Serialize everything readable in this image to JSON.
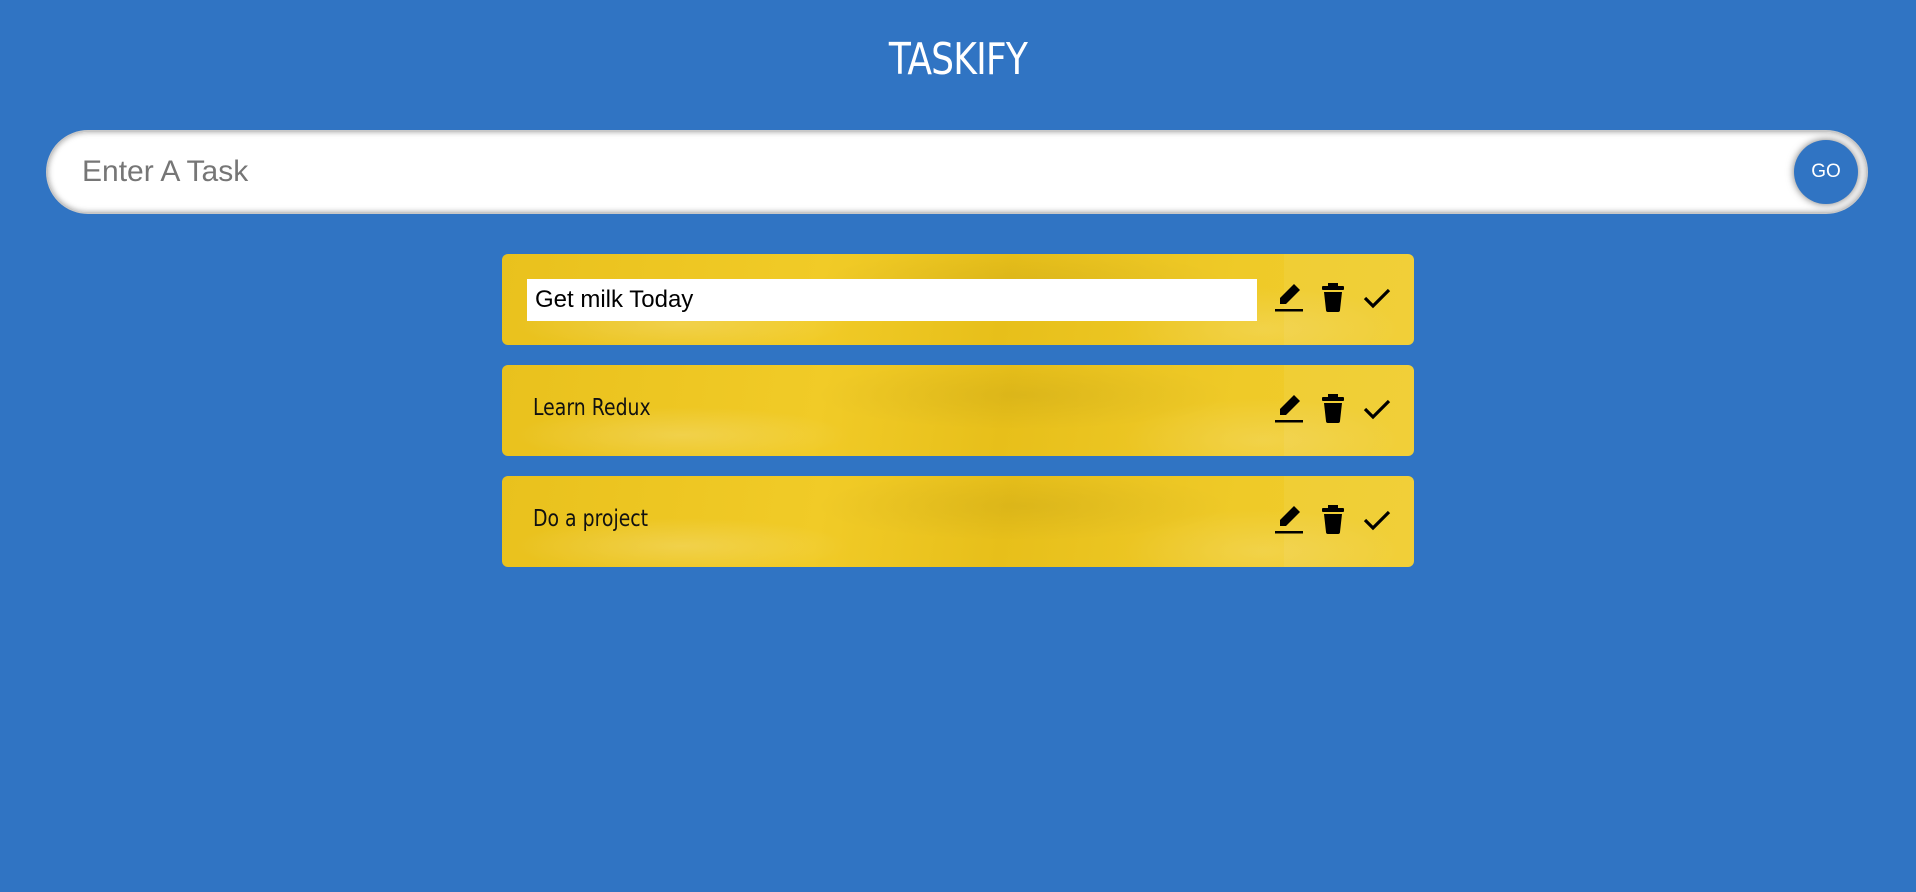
{
  "app": {
    "title": "TASKIFY"
  },
  "input_bar": {
    "placeholder": "Enter A Task",
    "value": "",
    "submit_label": "GO"
  },
  "tasks": [
    {
      "text": "Get milk Today",
      "editing": true,
      "icons": [
        "edit-icon",
        "delete-icon",
        "done-icon"
      ]
    },
    {
      "text": "Learn Redux",
      "editing": false,
      "icons": [
        "edit-icon",
        "delete-icon",
        "done-icon"
      ]
    },
    {
      "text": "Do a project",
      "editing": false,
      "icons": [
        "edit-icon",
        "delete-icon",
        "done-icon"
      ]
    }
  ],
  "colors": {
    "background": "#3074c3",
    "card": "#efc823",
    "go_button": "#3074c3"
  }
}
